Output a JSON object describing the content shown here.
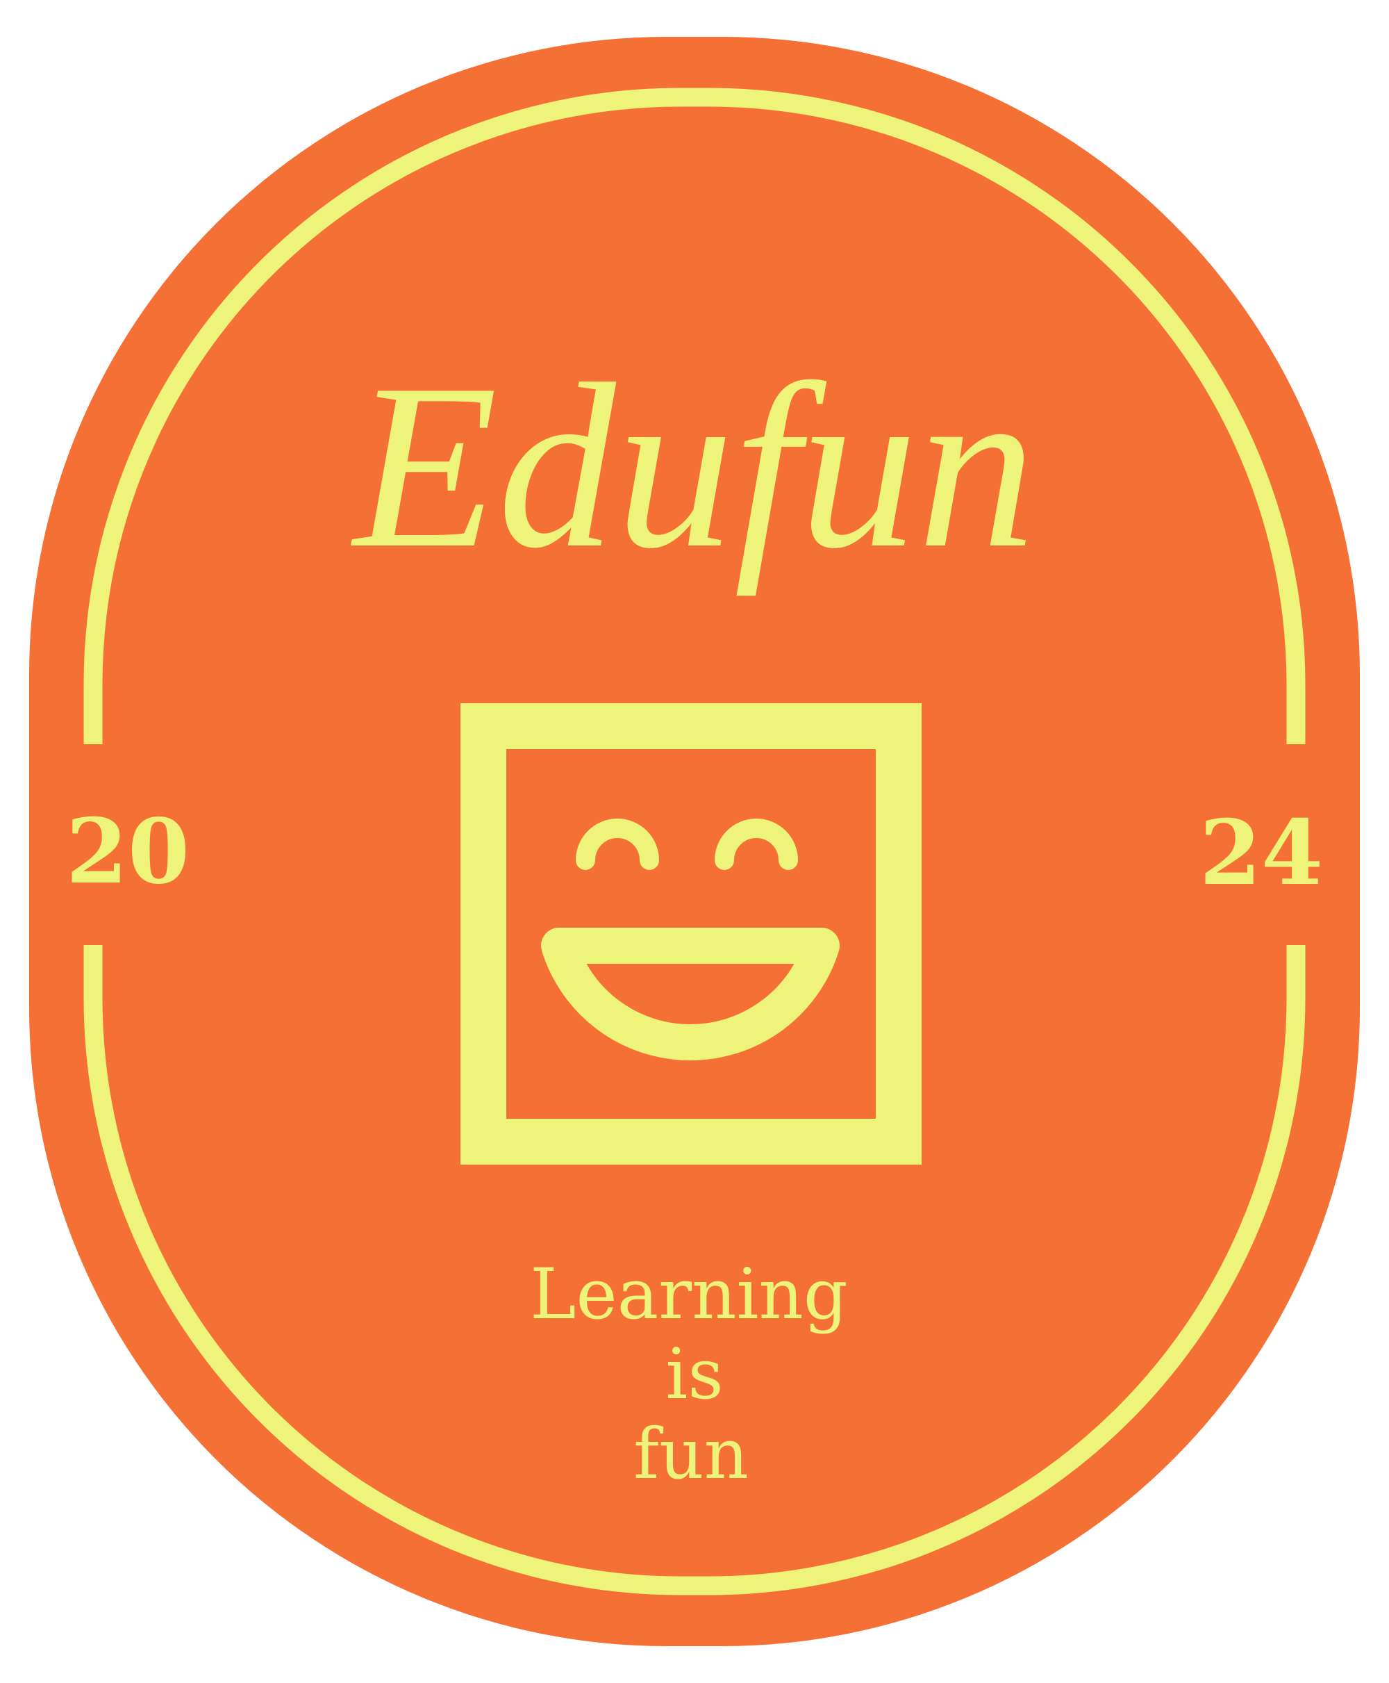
{
  "brand": {
    "name": "Edufun",
    "year_left": "20",
    "year_right": "24",
    "tagline": [
      "Learning",
      "is",
      "fun"
    ]
  },
  "icons": {
    "logo": "smiling-face-square-icon"
  },
  "colors": {
    "background": "#ffffff",
    "badge_fill": "#F57035",
    "accent": "#EEF37A"
  }
}
